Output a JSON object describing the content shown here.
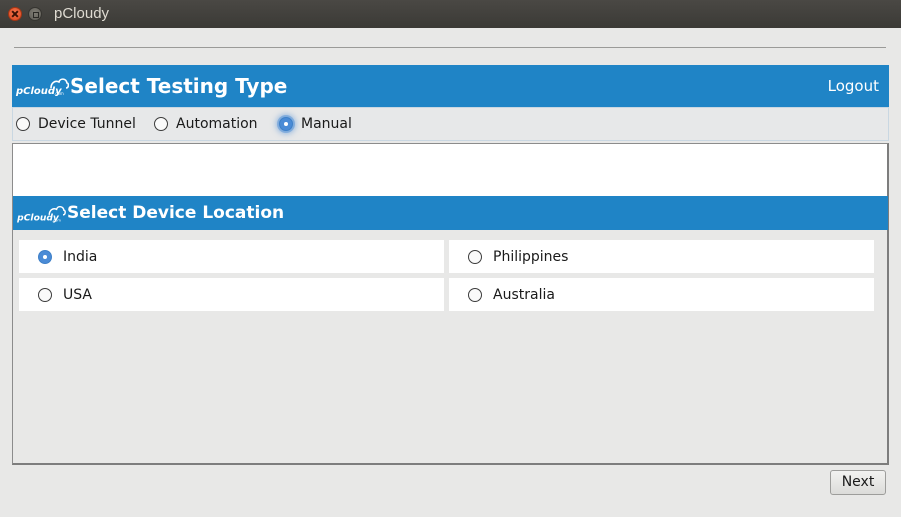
{
  "window": {
    "title": "pCloudy"
  },
  "header": {
    "title": "Select Testing Type",
    "logout_label": "Logout"
  },
  "testing_type": {
    "options": [
      {
        "label": "Device Tunnel",
        "checked": false
      },
      {
        "label": "Automation",
        "checked": false
      },
      {
        "label": "Manual",
        "checked": true
      }
    ]
  },
  "device_location": {
    "title": "Select Device Location",
    "options": [
      {
        "label": "India",
        "checked": true
      },
      {
        "label": "Philippines",
        "checked": false
      },
      {
        "label": "USA",
        "checked": false
      },
      {
        "label": "Australia",
        "checked": false
      }
    ]
  },
  "footer": {
    "next_label": "Next"
  },
  "logo": {
    "text": "pCloudy",
    "suffix": ".com"
  },
  "colors": {
    "brand_blue": "#1f84c6",
    "radio_checked": "#4a8bd6",
    "background": "#e8e8e7"
  }
}
